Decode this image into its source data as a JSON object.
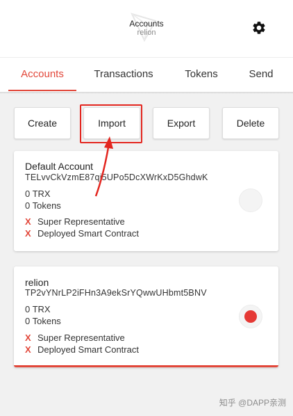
{
  "header": {
    "title": "Accounts",
    "subtitle": "relion",
    "settings_icon": "gear-icon"
  },
  "tabs": [
    {
      "label": "Accounts",
      "active": true
    },
    {
      "label": "Transactions",
      "active": false
    },
    {
      "label": "Tokens",
      "active": false
    },
    {
      "label": "Send",
      "active": false
    }
  ],
  "actions": {
    "create": "Create",
    "import": "Import",
    "export": "Export",
    "delete": "Delete"
  },
  "accounts": [
    {
      "name": "Default Account",
      "address": "TELvvCkVzmE87qi5UPo5DcXWrKxD5GhdwK",
      "balance": "0 TRX",
      "tokens": "0 Tokens",
      "flags": [
        "Super Representative",
        "Deployed Smart Contract"
      ],
      "flag_mark": "X",
      "selected": false
    },
    {
      "name": "relion",
      "address": "TP2vYNrLP2iFHn3A9ekSrYQwwUHbmt5BNV",
      "balance": "0 TRX",
      "tokens": "0 Tokens",
      "flags": [
        "Super Representative",
        "Deployed Smart Contract"
      ],
      "flag_mark": "X",
      "selected": true
    }
  ],
  "colors": {
    "accent": "#e2473a",
    "annotation": "#e3261f"
  },
  "watermark": "知乎 @DAPP亲测"
}
